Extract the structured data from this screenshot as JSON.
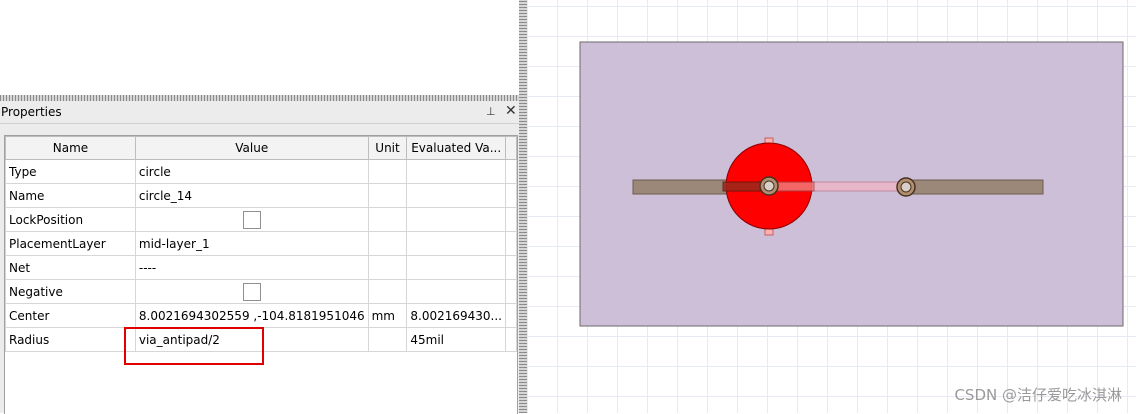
{
  "panel": {
    "title": "Properties",
    "pin_glyph": "⊥",
    "close_glyph": "✕"
  },
  "table": {
    "headers": [
      "Name",
      "Value",
      "Unit",
      "Evaluated Va..."
    ],
    "rows": [
      {
        "name": "Type",
        "value": "circle",
        "unit": "",
        "evaluated": "",
        "checkbox": false
      },
      {
        "name": "Name",
        "value": "circle_14",
        "unit": "",
        "evaluated": "",
        "checkbox": false
      },
      {
        "name": "LockPosition",
        "value": "",
        "unit": "",
        "evaluated": "",
        "checkbox": true
      },
      {
        "name": "PlacementLayer",
        "value": "mid-layer_1",
        "unit": "",
        "evaluated": "",
        "checkbox": false
      },
      {
        "name": "Net",
        "value": "----",
        "unit": "",
        "evaluated": "",
        "checkbox": false
      },
      {
        "name": "Negative",
        "value": "",
        "unit": "",
        "evaluated": "",
        "checkbox": true
      },
      {
        "name": "Center",
        "value": "8.0021694302559 ,-104.8181951046",
        "unit": "mm",
        "evaluated": "8.002169430...",
        "checkbox": false
      },
      {
        "name": "Radius",
        "value": "via_antipad/2",
        "unit": "",
        "evaluated": "45mil",
        "checkbox": false
      }
    ]
  },
  "canvas": {
    "board_color": "#cdbfd8",
    "antipad_color": "#ff0000",
    "trace_color": "#9c8878"
  },
  "watermark": "CSDN @洁仔爱吃冰淇淋"
}
